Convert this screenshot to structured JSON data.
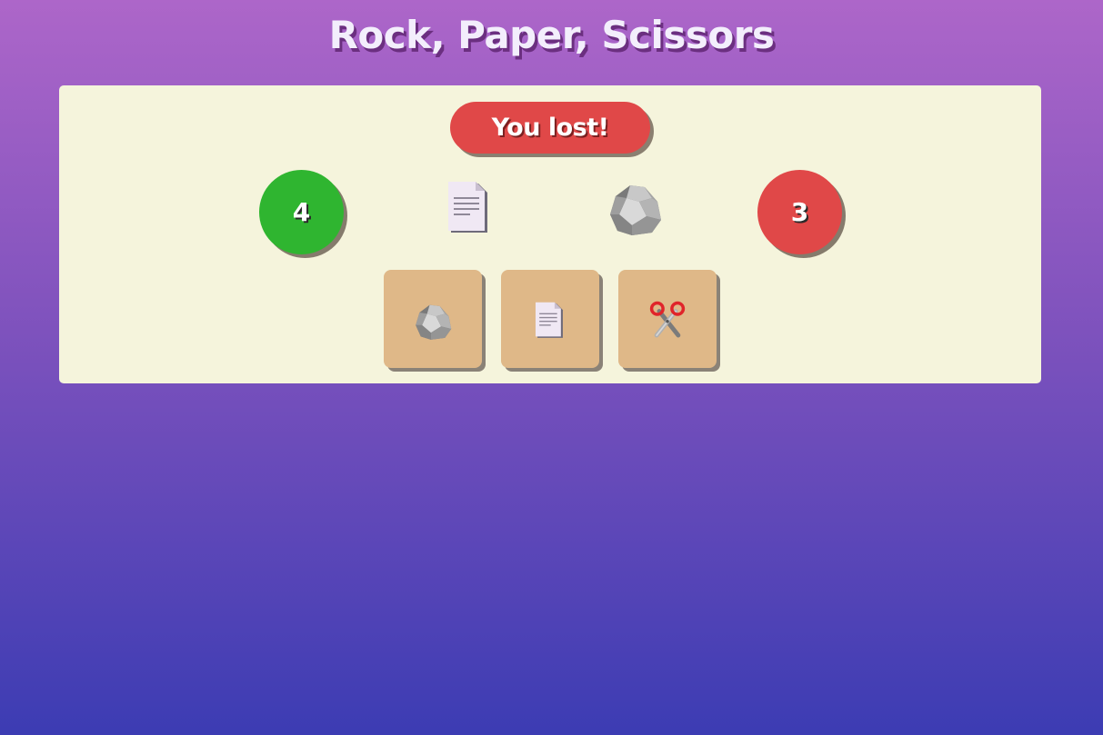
{
  "title": "Rock, Paper, Scissors",
  "result": {
    "text": "You lost!",
    "color": "#e04848"
  },
  "scores": {
    "player": "4",
    "player_color": "#2fb530",
    "cpu": "3",
    "cpu_color": "#e04848"
  },
  "round": {
    "player_choice_icon": "paper-icon",
    "cpu_choice_icon": "rock-icon"
  },
  "choices": [
    {
      "name": "rock",
      "icon": "rock-icon"
    },
    {
      "name": "paper",
      "icon": "paper-icon"
    },
    {
      "name": "scissors",
      "icon": "scissors-icon"
    }
  ],
  "colors": {
    "panel": "#f5f4dc",
    "choice_button": "#dfb888",
    "background_top": "#ad66c9",
    "background_bottom": "#3c3cb3"
  }
}
